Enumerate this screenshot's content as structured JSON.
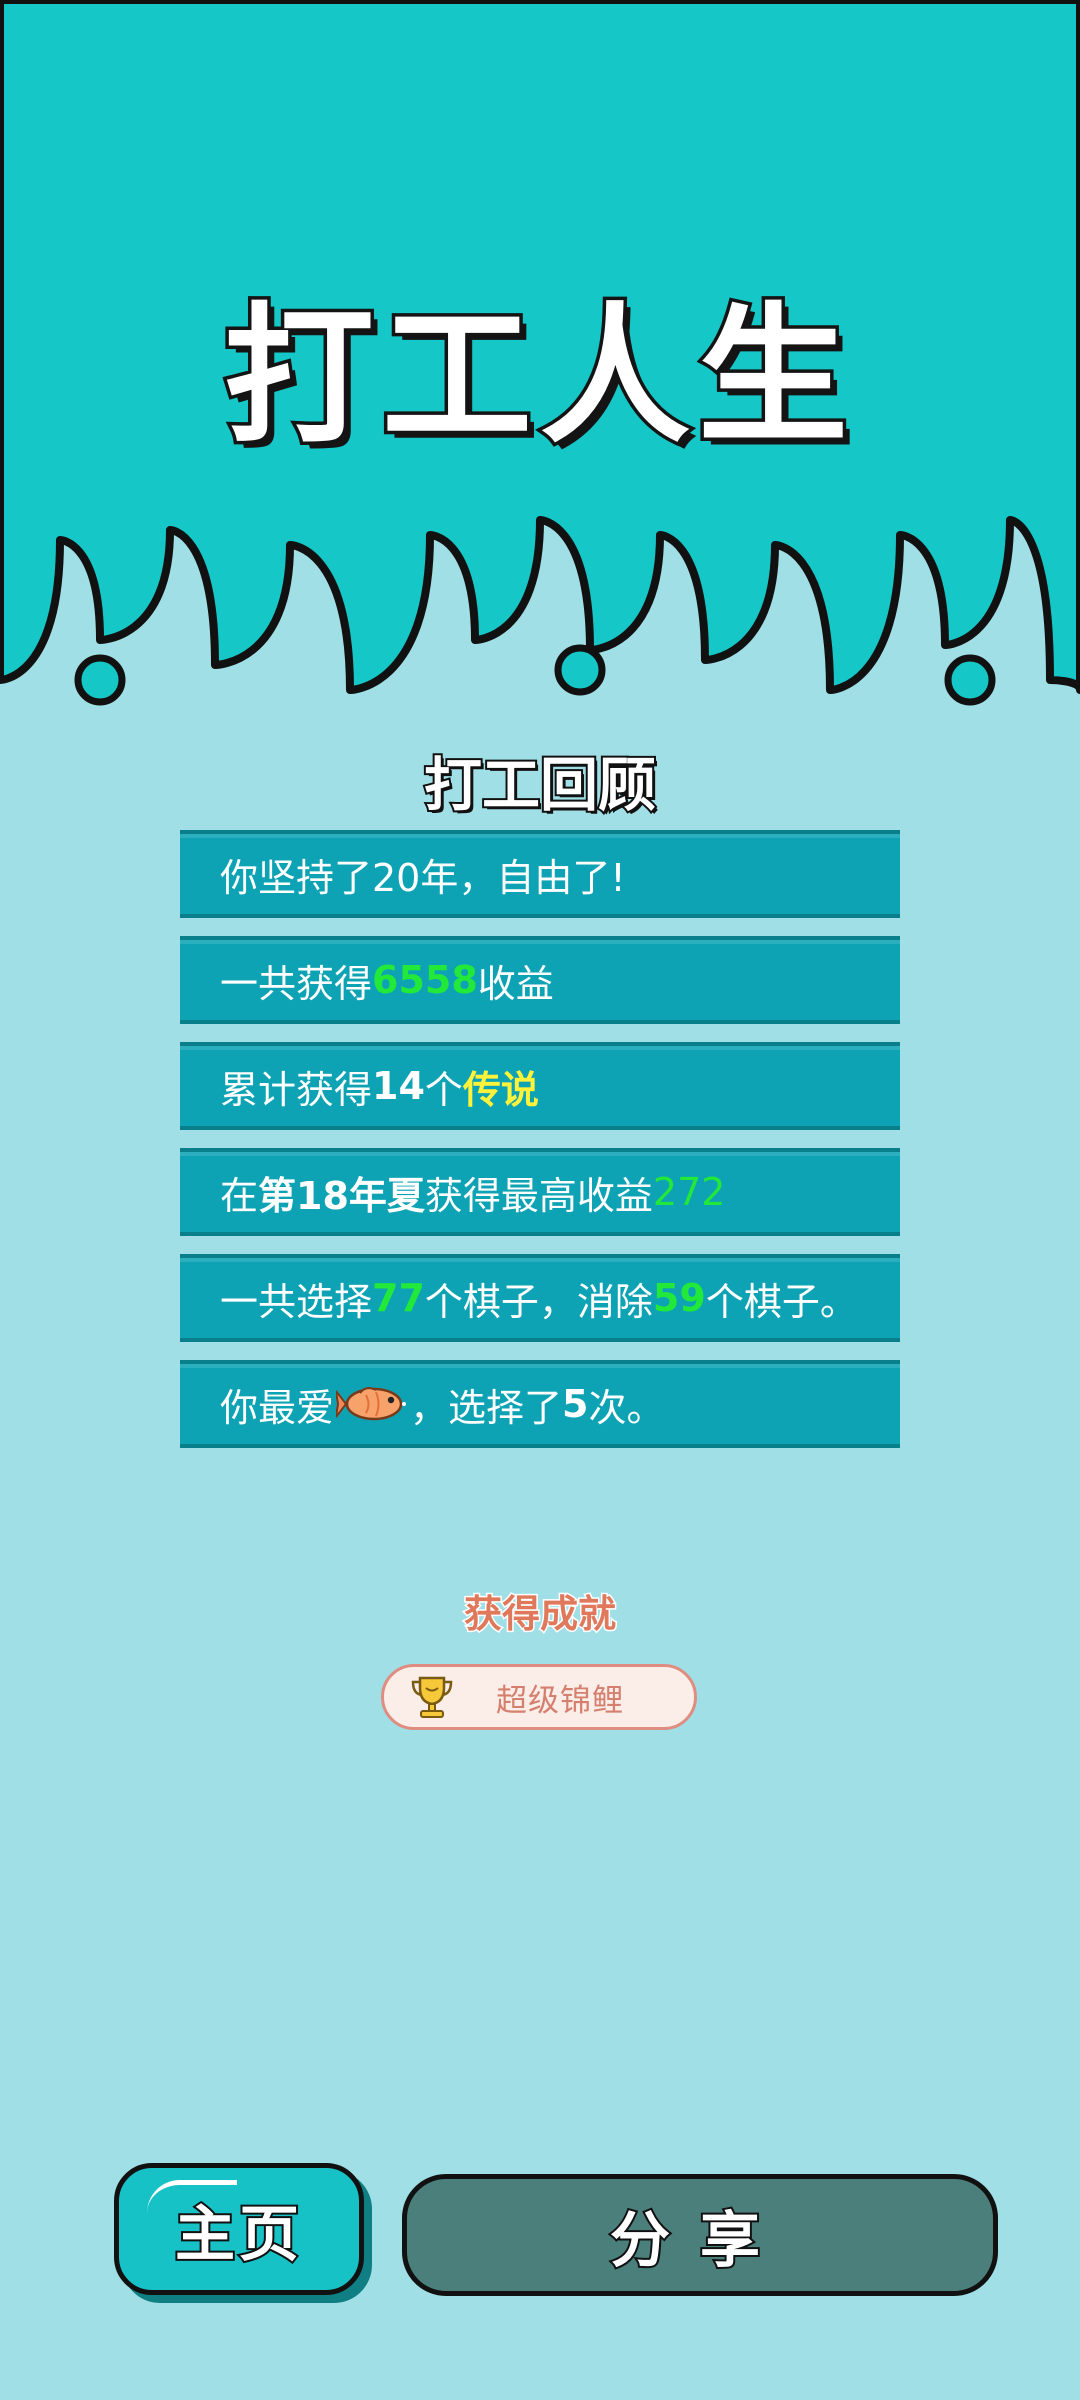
{
  "title": "打工人生",
  "review": {
    "heading": "打工回顾",
    "row1": {
      "text": "你坚持了20年，自由了!"
    },
    "row2": {
      "pre": "一共获得",
      "value": "6558",
      "post": "收益"
    },
    "row3": {
      "pre": "累计获得",
      "count": "14",
      "mid": "个",
      "rarity": "传说"
    },
    "row4": {
      "pre": "在 ",
      "season": "第18年夏",
      "mid": " 获得最高收益",
      "value": "272"
    },
    "row5": {
      "pre": "一共选择",
      "chosen": "77",
      "mid": "个棋子，消除",
      "removed": "59",
      "post": "个棋子。"
    },
    "row6": {
      "pre": "你最爱",
      "icon": "fish-icon",
      "mid": "，选择了",
      "count": "5",
      "post": "次。"
    }
  },
  "achievement": {
    "heading": "获得成就",
    "icon": "trophy-icon",
    "badge": "超级锦鲤"
  },
  "buttons": {
    "home": "主页",
    "share": "分享"
  },
  "colors": {
    "header": "#15c7c7",
    "background": "#a0dfe6",
    "row": "#0ea3b4",
    "highlight_green": "#22e83a",
    "highlight_yellow": "#fff23a"
  }
}
